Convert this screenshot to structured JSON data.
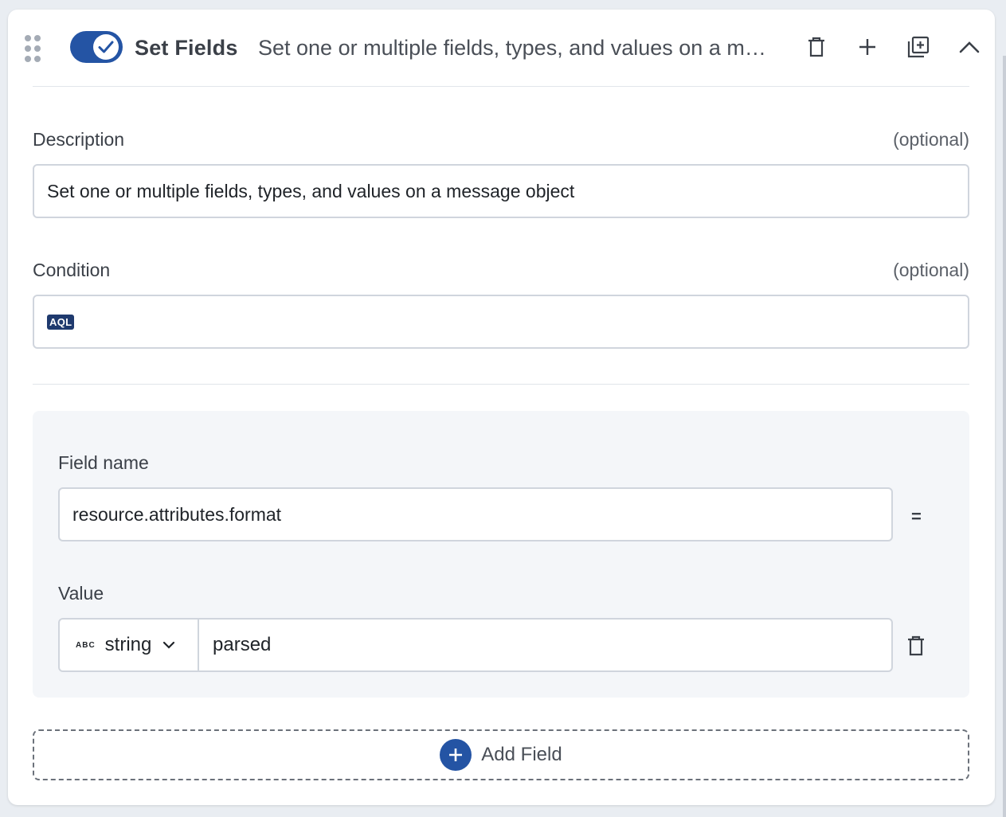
{
  "header": {
    "enabled": true,
    "title": "Set Fields",
    "summary": "Set one or multiple fields, types, and values on a m…",
    "icons": [
      "drag-handle-icon",
      "check-icon",
      "trash-icon",
      "plus-icon",
      "duplicate-icon",
      "chevron-up-icon"
    ]
  },
  "description": {
    "label": "Description",
    "optional": "(optional)",
    "value": "Set one or multiple fields, types, and values on a message object"
  },
  "condition": {
    "label": "Condition",
    "optional": "(optional)",
    "badge": "AQL",
    "value": ""
  },
  "fields": [
    {
      "name_label": "Field name",
      "name_value": "resource.attributes.format",
      "operator": "=",
      "value_label": "Value",
      "type_icon": "ABC",
      "type": "string",
      "value": "parsed"
    }
  ],
  "add_field_label": "Add Field",
  "colors": {
    "accent": "#2454a4",
    "badge": "#1f3a6e",
    "panel": "#f4f6f9",
    "border": "#d0d5dd"
  }
}
